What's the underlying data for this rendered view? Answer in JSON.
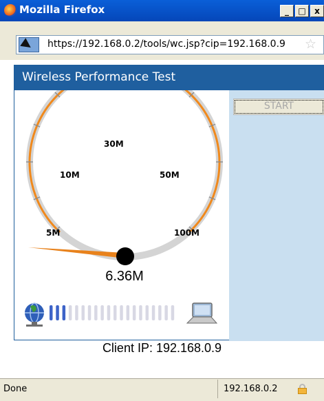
{
  "window": {
    "title": "Mozilla Firefox",
    "buttons": {
      "minimize": "_",
      "maximize": "□",
      "close": "x"
    }
  },
  "urlbar": {
    "url": "https://192.168.0.2/tools/wc.jsp?cip=192.168.0.9",
    "bookmark_icon": "star-icon"
  },
  "panel": {
    "title": "Wireless Performance Test",
    "start_label": "START"
  },
  "gauge": {
    "scale_labels": [
      "5M",
      "10M",
      "30M",
      "50M",
      "100M"
    ],
    "reading": "6.36M",
    "reading_value_mbps": 6.36,
    "arc_color": "#f0891c",
    "needle_color": "#e8821c"
  },
  "signal": {
    "bars_total": 20,
    "bars_active": 3,
    "active_color": "#3d63c8",
    "inactive_color": "#d8d8e4",
    "left_icon": "globe-network-icon",
    "right_icon": "laptop-icon"
  },
  "client": {
    "label": "Client IP: 192.168.0.9"
  },
  "status": {
    "text": "Done",
    "host": "192.168.0.2",
    "lock_icon": "lock-icon"
  }
}
